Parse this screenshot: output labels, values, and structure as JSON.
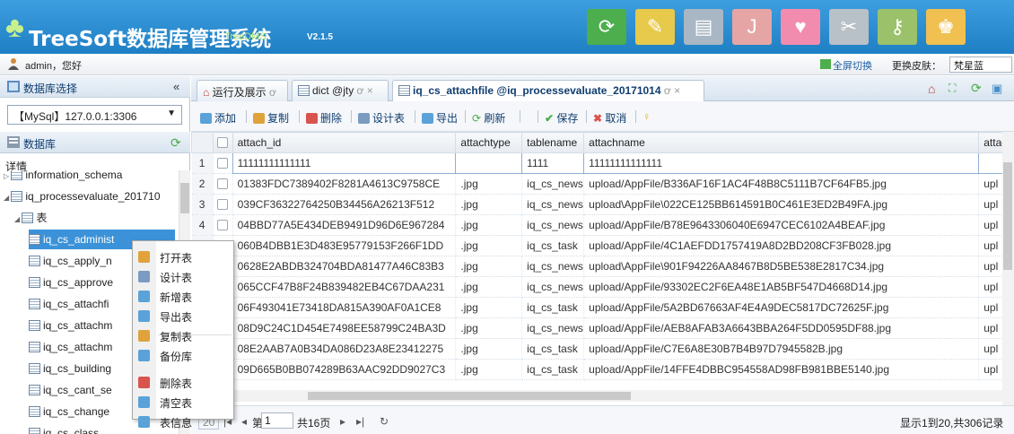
{
  "header": {
    "logo_text": "TreeSoft数据库管理系统",
    "sub": "TreeDMS",
    "version": "V2.1.5",
    "icons": [
      {
        "name": "refresh-icon",
        "glyph": "⟳",
        "color": "#4cae4c"
      },
      {
        "name": "edit-icon",
        "glyph": "✎",
        "color": "#e7c94b"
      },
      {
        "name": "database-icon",
        "glyph": "▤",
        "color": "#a9b7c4"
      },
      {
        "name": "doc-icon",
        "glyph": "J",
        "color": "#e6a5a5"
      },
      {
        "name": "heart-icon",
        "glyph": "♥",
        "color": "#f28cae"
      },
      {
        "name": "tools-icon",
        "glyph": "✂",
        "color": "#b8c0c8"
      },
      {
        "name": "key-icon",
        "glyph": "⚷",
        "color": "#9bc26b"
      },
      {
        "name": "user-icon",
        "glyph": "♚",
        "color": "#f0c050"
      }
    ]
  },
  "userbar": {
    "user": "admin，您好",
    "fullscreen": "全屏切换",
    "skin_label": "更换皮肤：",
    "skin_value": "梵星蓝"
  },
  "left": {
    "db_select_title": "数据库选择",
    "db_select_value": "【MySql】127.0.0.1:3306",
    "db_title": "数据库",
    "detail": "详情",
    "tree": [
      "information_schema",
      "iq_processevaluate_201710",
      "表",
      "iq_cs_administ",
      "iq_cs_apply_n",
      "iq_cs_approve",
      "iq_cs_attachfi",
      "iq_cs_attachm",
      "iq_cs_attachm",
      "iq_cs_building",
      "iq_cs_cant_se",
      "iq_cs_change",
      "iq_cs_class"
    ]
  },
  "context_menu": [
    "打开表",
    "设计表",
    "新增表",
    "导出表",
    "复制表",
    "备份库",
    "删除表",
    "清空表",
    "表信息"
  ],
  "tabs": [
    "运行及展示",
    "dict @jty",
    "iq_cs_attachfile @iq_processevaluate_20171014"
  ],
  "toolbar": [
    "添加",
    "复制",
    "删除",
    "设计表",
    "导出",
    "刷新",
    "保存",
    "取消"
  ],
  "grid": {
    "columns": [
      "attach_id",
      "attachtype",
      "tablename",
      "attachname",
      "attach"
    ],
    "rows": [
      [
        "1",
        "11111111111111",
        "",
        "1111",
        "11111111111111",
        ""
      ],
      [
        "2",
        "01383FDC7389402F8281A4613C9758CE",
        ".jpg",
        "iq_cs_news",
        "upload/AppFile/B336AF16F1AC4F48B8C5111B7CF64FB5.jpg",
        "upl"
      ],
      [
        "3",
        "039CF36322764250B34456A26213F512",
        ".jpg",
        "iq_cs_news",
        "upload\\AppFile\\022CE125BB614591B0C461E3ED2B49FA.jpg",
        "upl"
      ],
      [
        "4",
        "04BBD77A5E434DEB9491D96D6E967284",
        ".jpg",
        "iq_cs_news",
        "upload/AppFile/B78E9643306040E6947CEC6102A4BEAF.jpg",
        "upl"
      ],
      [
        "5",
        "060B4DBB1E3D483E95779153F266F1DD",
        ".jpg",
        "iq_cs_task",
        "upload/AppFile/4C1AEFDD1757419A8D2BD208CF3FB028.jpg",
        "upl"
      ],
      [
        "6",
        "0628E2ABDB324704BDA81477A46C83B3",
        ".jpg",
        "iq_cs_news",
        "upload\\AppFile\\901F94226AA8467B8D5BE538E2817C34.jpg",
        "upl"
      ],
      [
        "7",
        "065CCF47B8F24B839482EB4C67DAA231",
        ".jpg",
        "iq_cs_news",
        "upload/AppFile/93302EC2F6EA48E1AB5BF547D4668D14.jpg",
        "upl"
      ],
      [
        "8",
        "06F493041E73418DA815A390AF0A1CE8",
        ".jpg",
        "iq_cs_task",
        "upload/AppFile/5A2BD67663AF4E4A9DEC5817DC72625F.jpg",
        "upl"
      ],
      [
        "9",
        "08D9C24C1D454E7498EE58799C24BA3D",
        ".jpg",
        "iq_cs_news",
        "upload/AppFile/AEB8AFAB3A6643BBA264F5DD0595DF88.jpg",
        "upl"
      ],
      [
        "10",
        "08E2AAB7A0B34DA086D23A8E23412275",
        ".jpg",
        "iq_cs_task",
        "upload/AppFile/C7E6A8E30B7B4B97D7945582B.jpg",
        "upl"
      ],
      [
        "11",
        "09D665B0BB074289B63AAC92DD9027C3",
        ".jpg",
        "iq_cs_task",
        "upload/AppFile/14FFE4DBBC954558AD98FB981BBE5140.jpg",
        "upl"
      ]
    ]
  },
  "pager": {
    "page_label": "第",
    "page": "1",
    "total": "共16页",
    "summary": "显示1到20,共306记录"
  }
}
